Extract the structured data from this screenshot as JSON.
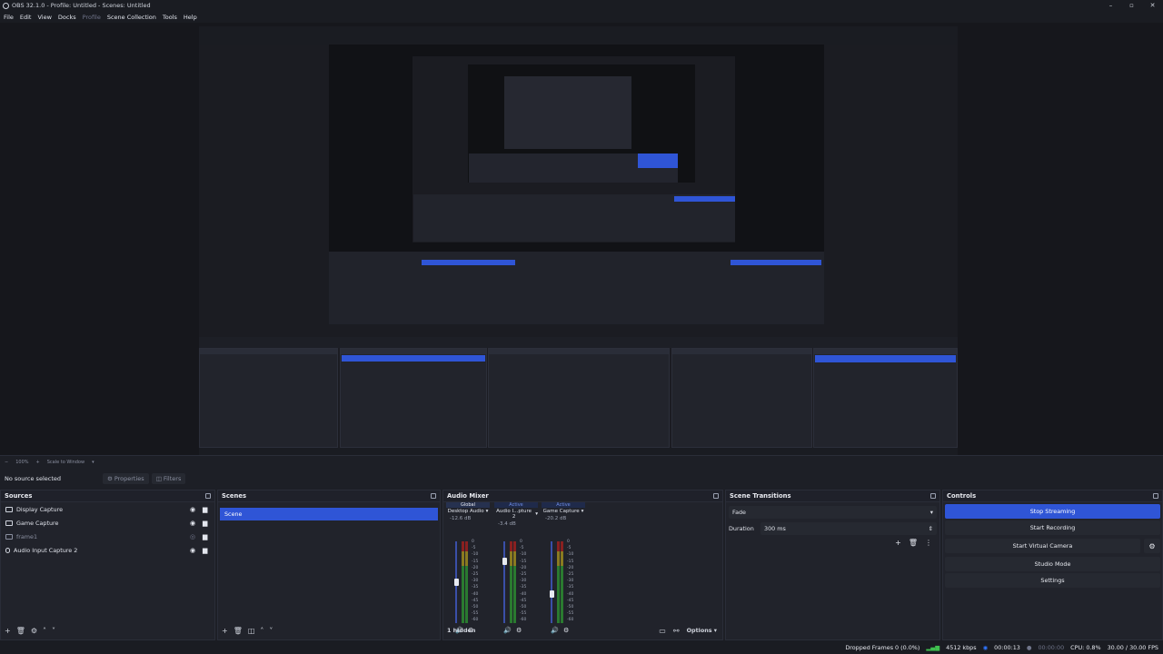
{
  "window": {
    "title": "OBS 32.1.0 - Profile: Untitled - Scenes: Untitled",
    "minimize": "–",
    "maximize": "▫",
    "close": "✕"
  },
  "menu": [
    "File",
    "Edit",
    "View",
    "Docks",
    "Profile",
    "Scene Collection",
    "Tools",
    "Help"
  ],
  "preview_bar": {
    "zoom": "100%",
    "scale_mode": "Scale to Window"
  },
  "source_toolbar": {
    "status": "No source selected",
    "properties": "Properties",
    "filters": "Filters"
  },
  "sources": {
    "title": "Sources",
    "items": [
      {
        "name": "Display Capture",
        "visible": true
      },
      {
        "name": "Game Capture",
        "visible": true
      },
      {
        "name": "frame1",
        "visible": false
      },
      {
        "name": "Audio Input Capture 2",
        "visible": true
      }
    ]
  },
  "scenes": {
    "title": "Scenes",
    "items": [
      "Scene"
    ]
  },
  "mixer": {
    "title": "Audio Mixer",
    "channels": [
      {
        "header": "Global",
        "name": "Desktop Audio",
        "db": "-12.6 dB",
        "level": 0.55
      },
      {
        "header": "Active",
        "name": "Audio I...pture 2",
        "db": "-3.4 dB",
        "level": 0.8
      },
      {
        "header": "Active",
        "name": "Game Capture",
        "db": "-20.2 dB",
        "level": 0.4
      }
    ],
    "hidden": "1 hidden",
    "options": "Options",
    "ticks": [
      "0",
      "-5",
      "-10",
      "-15",
      "-20",
      "-25",
      "-30",
      "-35",
      "-40",
      "-45",
      "-50",
      "-55",
      "-60"
    ]
  },
  "transitions": {
    "title": "Scene Transitions",
    "selected": "Fade",
    "duration_label": "Duration",
    "duration": "300 ms"
  },
  "controls": {
    "title": "Controls",
    "buttons": [
      "Stop Streaming",
      "Start Recording",
      "Start Virtual Camera",
      "Studio Mode",
      "Settings"
    ]
  },
  "status": {
    "dropped": "Dropped Frames 0 (0.0%)",
    "bitrate": "4512 kbps",
    "stream_time": "00:00:13",
    "rec_time": "00:00:00",
    "cpu": "CPU: 0.8%",
    "fps": "30.00 / 30.00 FPS"
  }
}
